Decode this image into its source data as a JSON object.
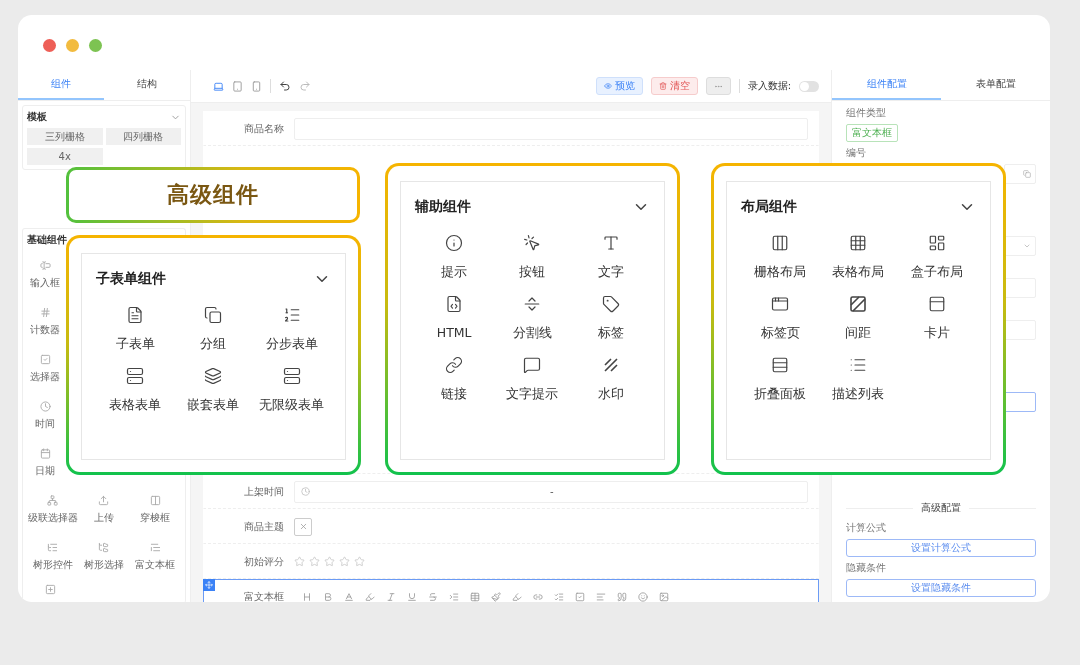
{
  "window_controls": [
    {
      "color": "#ee5f57"
    },
    {
      "color": "#f2bb3f"
    },
    {
      "color": "#7dc352"
    }
  ],
  "left_panel": {
    "tabs": [
      {
        "label": "组件",
        "selected": true
      },
      {
        "label": "结构",
        "selected": false
      }
    ],
    "template": {
      "title": "模板",
      "items": [
        "三列栅格",
        "四列栅格",
        "4x"
      ]
    },
    "basic": {
      "title": "基础组件",
      "column_items": [
        "输入框",
        "计数器",
        "选择器",
        "时间",
        "日期"
      ],
      "grid_items": [
        "级联选择器",
        "上传",
        "穿梭框",
        "树形控件",
        "树形选择",
        "富文本框"
      ]
    }
  },
  "toolbar": {
    "devices": [
      {
        "selected": true
      },
      {
        "selected": false
      },
      {
        "selected": false
      }
    ],
    "buttons": [
      {
        "label": "预览",
        "kind": "primary"
      },
      {
        "label": "清空",
        "kind": "danger"
      }
    ],
    "entry_switch": {
      "label": "录入数据:",
      "on": false
    }
  },
  "form": {
    "top_rows": [
      {
        "label": "商品名称"
      }
    ],
    "lower_rows": [
      {
        "label": "上架时间",
        "kind": "date-range",
        "separator": "-",
        "selected": false
      },
      {
        "label": "商品主题",
        "kind": "upload",
        "selected": false
      },
      {
        "label": "初始评分",
        "kind": "rating",
        "stars": 0,
        "selected": false
      },
      {
        "label": "富文本框",
        "kind": "rich-text",
        "selected": true
      }
    ]
  },
  "right_panel": {
    "tabs": [
      {
        "label": "组件配置",
        "selected": true
      },
      {
        "label": "表单配置",
        "selected": false
      }
    ],
    "type_label": "组件类型",
    "type_tag": "富文本框",
    "id_label": "编号",
    "advanced": {
      "title": "高级配置",
      "items": [
        {
          "label": "计算公式",
          "button": "设置计算公式"
        },
        {
          "label": "隐藏条件",
          "button": "设置隐藏条件"
        }
      ]
    }
  },
  "overlay": {
    "title": "高级组件",
    "panels": [
      {
        "kind": "subform",
        "title": "子表单组件",
        "items": [
          "子表单",
          "分组",
          "分步表单",
          "表格表单",
          "嵌套表单",
          "无限级表单"
        ]
      },
      {
        "kind": "auxiliary",
        "title": "辅助组件",
        "items": [
          "提示",
          "按钮",
          "文字",
          "HTML",
          "分割线",
          "标签",
          "链接",
          "文字提示",
          "水印"
        ]
      },
      {
        "kind": "layout",
        "title": "布局组件",
        "items": [
          "栅格布局",
          "表格布局",
          "盒子布局",
          "标签页",
          "间距",
          "卡片",
          "折叠面板",
          "描述列表"
        ]
      }
    ]
  }
}
